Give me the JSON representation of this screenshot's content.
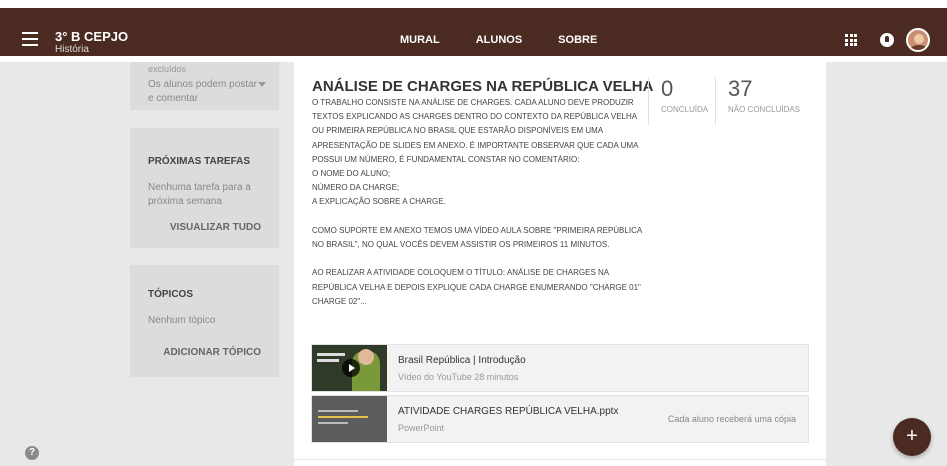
{
  "header": {
    "class_name": "3° B CEPJO",
    "subject": "História",
    "tabs": [
      {
        "label": "MURAL",
        "active": true
      },
      {
        "label": "ALUNOS",
        "active": false
      },
      {
        "label": "SOBRE",
        "active": false
      }
    ],
    "brand_color": "#4b2a22"
  },
  "sidebar": {
    "faded_text": "excluídos",
    "permission_select": "Os alunos podem postar e comentar",
    "upcoming": {
      "title": "PRÓXIMAS TAREFAS",
      "empty_text": "Nenhuma tarefa para a próxima semana",
      "link": "VISUALIZAR TUDO"
    },
    "topics": {
      "title": "TÓPICOS",
      "empty_text": "Nenhum tópico",
      "link": "ADICIONAR TÓPICO"
    }
  },
  "assignment": {
    "title": "ANÁLISE DE CHARGES NA REPÚBLICA VELHA",
    "body": [
      "O TRABALHO CONSISTE NA ANÁLISE DE CHARGES. CADA ALUNO DEVE PRODUZIR TEXTOS EXPLICANDO AS CHARGES DENTRO DO CONTEXTO DA REPÚBLICA VELHA OU PRIMEIRA REPÚBLICA NO BRASIL QUE ESTARÃO DISPONÍVEIS EM UMA APRESENTAÇÃO DE SLIDES EM ANEXO. É IMPORTANTE OBSERVAR QUE CADA UMA POSSUI UM NÚMERO, É FUNDAMENTAL CONSTAR NO COMENTÁRIO:",
      "O NOME DO ALUNO;",
      "NÚMERO DA CHARGE;",
      "A EXPLICAÇÃO SOBRE A CHARGE.",
      "",
      "COMO SUPORTE EM ANEXO TEMOS UMA VÍDEO AULA SOBRE \"PRIMEIRA REPÚBLICA NO BRASIL\", NO QUAL VOCÊS DEVEM ASSISTIR OS PRIMEIROS 11 MINUTOS.",
      "",
      "AO REALIZAR A ATIVIDADE COLOQUEM O TÍTULO: ANÁLISE DE CHARGES NA REPÚBLICA VELHA E DEPOIS EXPLIQUE CADA CHARGE ENUMERANDO \"CHARGE 01\" CHARGE 02\"..."
    ],
    "stats": {
      "done_count": "0",
      "done_label": "CONCLUÍDA",
      "not_done_count": "37",
      "not_done_label": "NÃO CONCLUÍDAS"
    },
    "attachments": [
      {
        "title": "Brasil República | Introdução",
        "subtitle": "Vídeo do YouTube  28 minutos",
        "note": ""
      },
      {
        "title": "ATIVIDADE CHARGES REPÚBLICA VELHA.pptx",
        "subtitle": "PowerPoint",
        "note": "Cada aluno receberá uma cópia"
      }
    ]
  },
  "fab_label": "+",
  "help_label": "?"
}
